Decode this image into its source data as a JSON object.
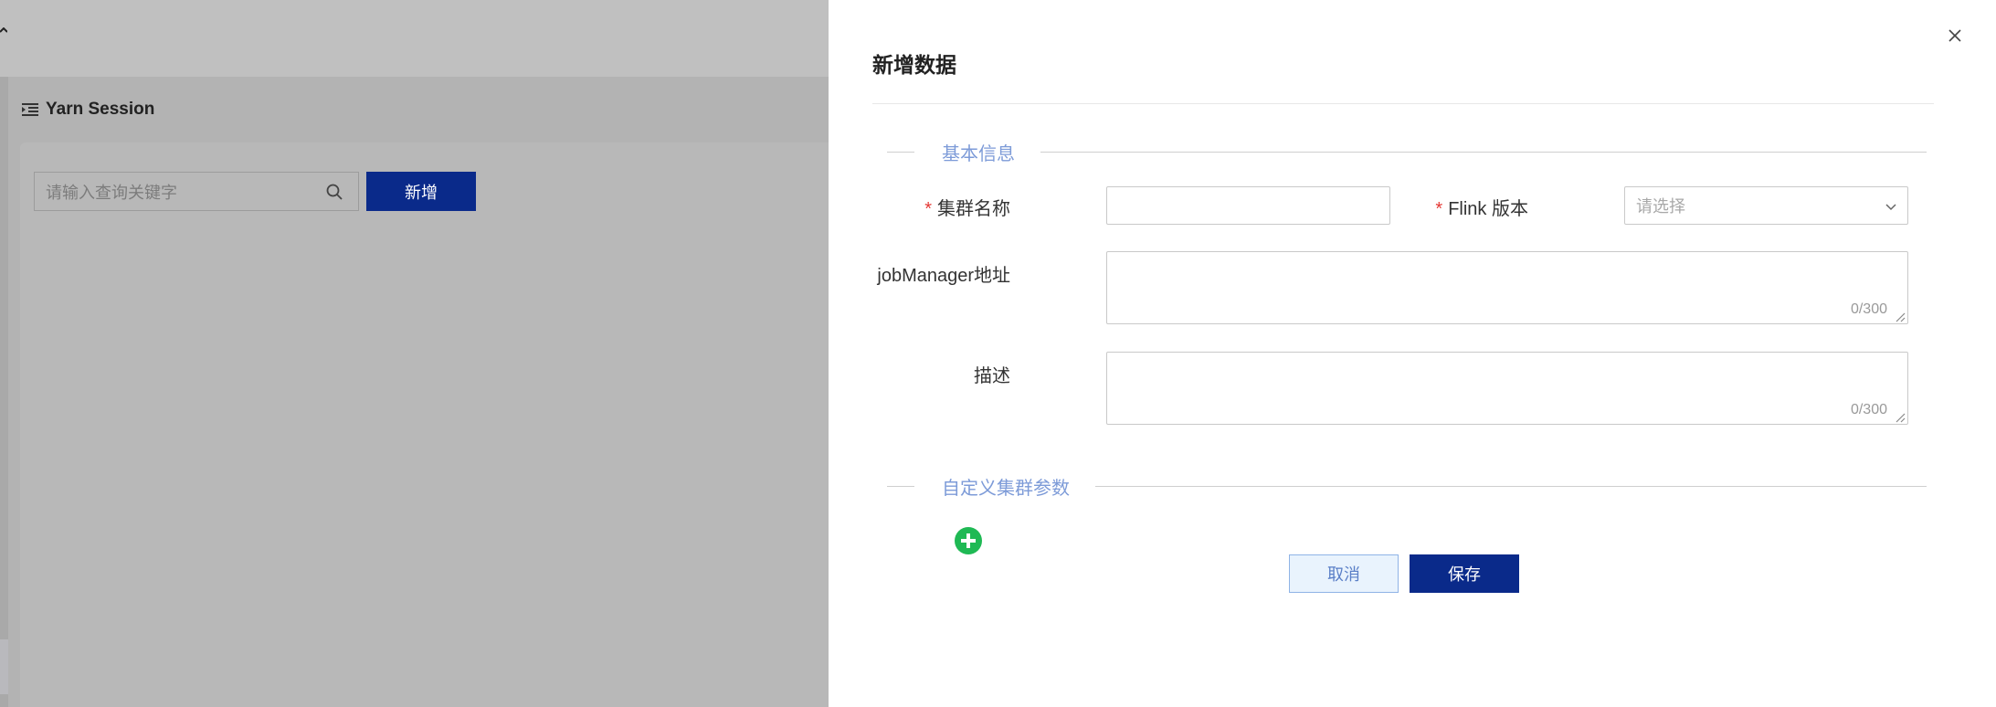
{
  "background": {
    "page_title": "Yarn Session",
    "search_placeholder": "请输入查询关键字",
    "add_button_label": "新增"
  },
  "drawer": {
    "title": "新增数据",
    "sections": {
      "basic": "基本信息",
      "custom_params": "自定义集群参数"
    },
    "fields": {
      "cluster_name": {
        "label": "集群名称",
        "required": "*",
        "value": ""
      },
      "flink_version": {
        "label": "Flink 版本",
        "required": "*",
        "placeholder": "请选择"
      },
      "job_manager": {
        "label": "jobManager地址",
        "counter": "0/300"
      },
      "description": {
        "label": "描述",
        "counter": "0/300"
      }
    },
    "buttons": {
      "cancel": "取消",
      "save": "保存"
    }
  },
  "colors": {
    "primary": "#0a2a8a",
    "section_label": "#7d9bd8",
    "add_icon": "#1fb954",
    "required": "#e53935"
  }
}
